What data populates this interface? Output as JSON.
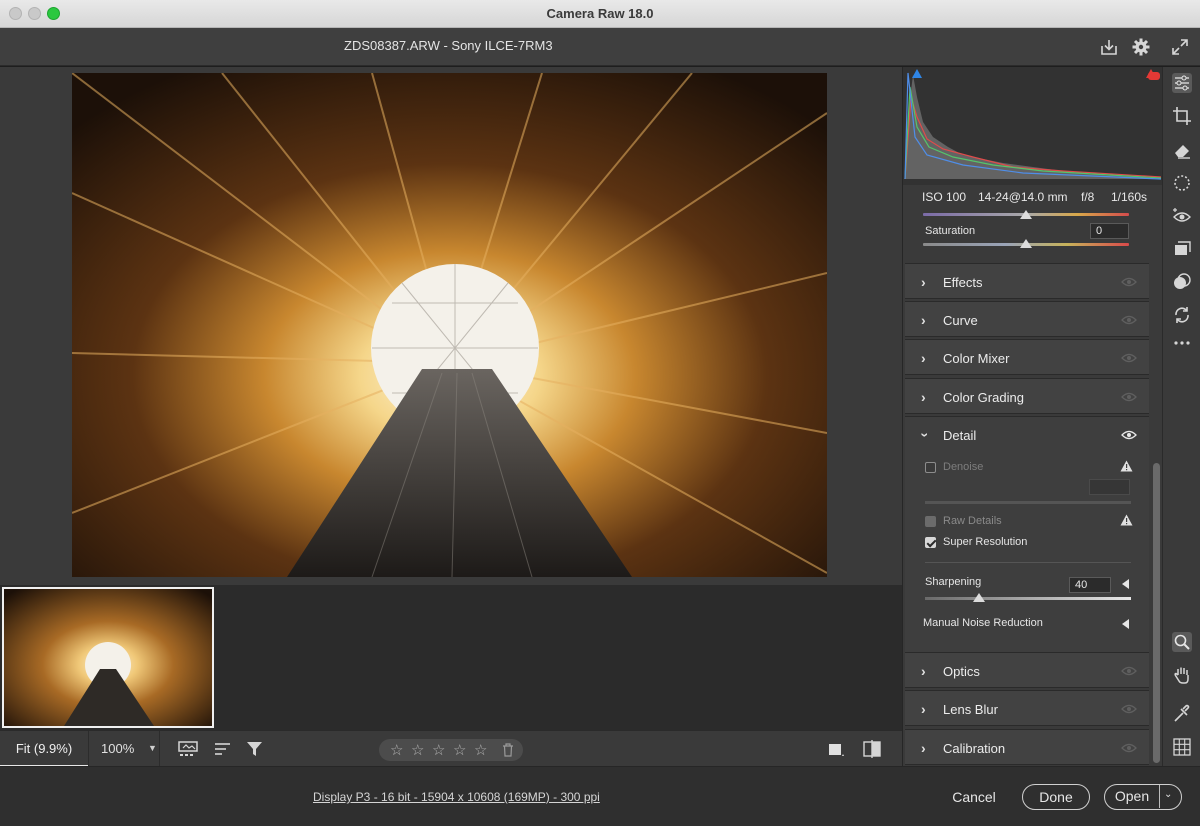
{
  "window": {
    "title": "Camera Raw 18.0"
  },
  "header": {
    "file_title": "ZDS08387.ARW  -  Sony ILCE-7RM3",
    "icons": [
      "save-icon",
      "gear-icon",
      "fullscreen-icon"
    ]
  },
  "histogram_info": {
    "iso": "ISO 100",
    "lens": "14-24@14.0 mm",
    "aperture": "f/8",
    "shutter": "1/160s"
  },
  "saturation": {
    "label": "Saturation",
    "value": "0"
  },
  "sections": {
    "effects": "Effects",
    "curve": "Curve",
    "color_mixer": "Color Mixer",
    "color_grading": "Color Grading",
    "detail": "Detail",
    "optics": "Optics",
    "lens_blur": "Lens Blur",
    "calibration": "Calibration"
  },
  "detail": {
    "denoise": "Denoise",
    "raw_details": "Raw Details",
    "super_resolution": "Super Resolution",
    "sharpening_label": "Sharpening",
    "sharpening_value": "40",
    "manual_noise_reduction": "Manual Noise Reduction",
    "denoise_checked": false,
    "raw_details_checked": true,
    "super_resolution_checked": true
  },
  "bottom_toolbar": {
    "zoom_fit": "Fit (9.9%)",
    "zoom_100": "100%",
    "stars": [
      "☆",
      "☆",
      "☆",
      "☆",
      "☆"
    ],
    "rating": 0
  },
  "footer": {
    "workflow": "Display P3 - 16 bit - 15904 x 10608 (169MP) - 300 ppi",
    "cancel": "Cancel",
    "done": "Done",
    "open": "Open"
  },
  "colors": {
    "panel_bg": "#3a3a3a",
    "section_bg": "#424242",
    "accent_clip_shadow": "#1f7ae0",
    "accent_clip_highlight": "#e53935"
  }
}
